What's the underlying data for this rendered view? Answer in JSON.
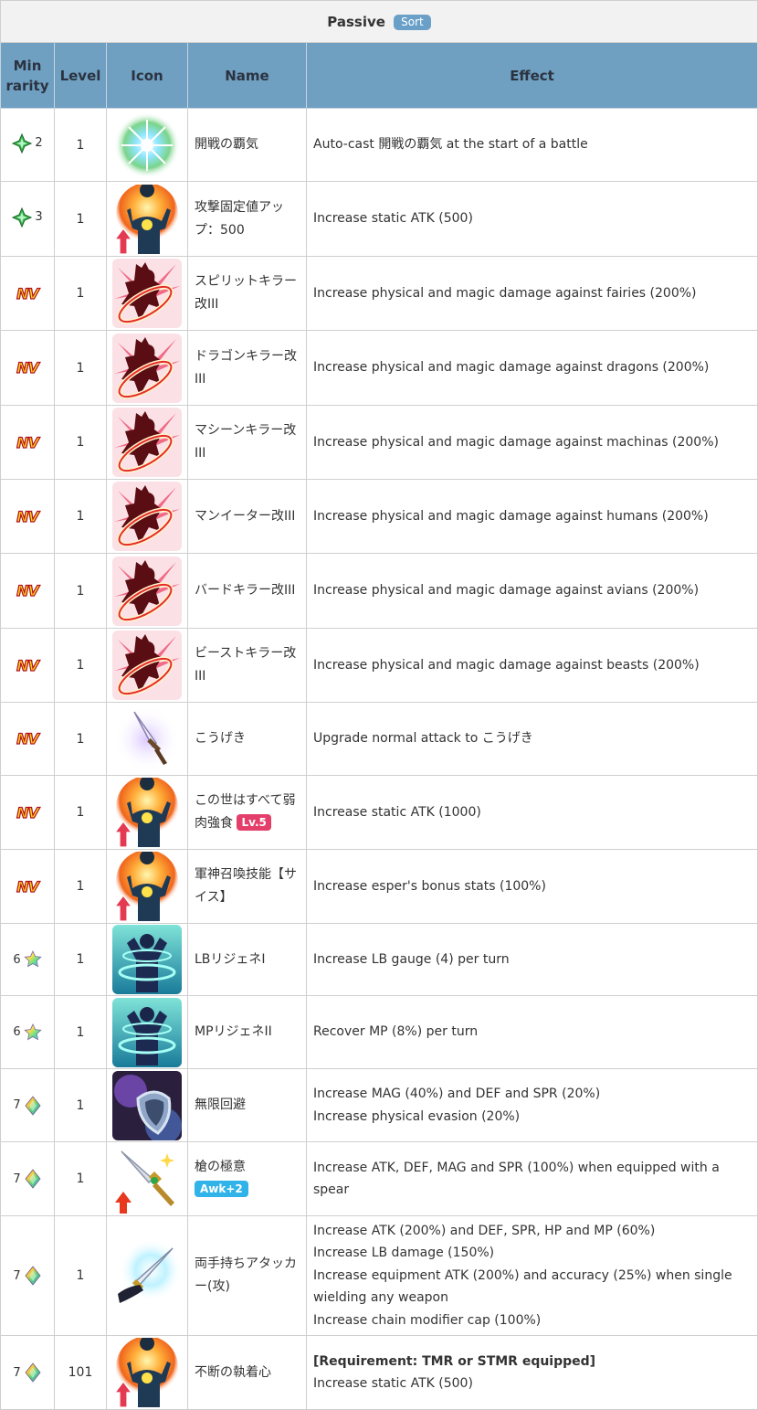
{
  "caption": {
    "title": "Passive",
    "sort_label": "Sort"
  },
  "headers": {
    "min_rarity_1": "Min",
    "min_rarity_2": "rarity",
    "level": "Level",
    "icon": "Icon",
    "name": "Name",
    "effect": "Effect"
  },
  "rows": [
    {
      "rarity": "2",
      "rarity_icon": "green-crystal-icon",
      "level": "1",
      "icon": "battle-aura-icon",
      "name": "開戦の覇気",
      "effects": [
        "Auto-cast 開戦の覇気 at the start of a battle"
      ]
    },
    {
      "rarity": "3",
      "rarity_icon": "green-crystal-icon",
      "level": "1",
      "icon": "stat-up-icon",
      "name": "攻撃固定値アップ：500",
      "effects": [
        "Increase static ATK (500)"
      ]
    },
    {
      "rarity": "NV",
      "rarity_icon": "nv-icon",
      "level": "1",
      "icon": "killer-icon",
      "name": "スピリットキラー改III",
      "effects": [
        "Increase physical and magic damage against fairies (200%)"
      ]
    },
    {
      "rarity": "NV",
      "rarity_icon": "nv-icon",
      "level": "1",
      "icon": "killer-icon",
      "name": "ドラゴンキラー改III",
      "effects": [
        "Increase physical and magic damage against dragons (200%)"
      ]
    },
    {
      "rarity": "NV",
      "rarity_icon": "nv-icon",
      "level": "1",
      "icon": "killer-icon",
      "name": "マシーンキラー改III",
      "effects": [
        "Increase physical and magic damage against machinas (200%)"
      ]
    },
    {
      "rarity": "NV",
      "rarity_icon": "nv-icon",
      "level": "1",
      "icon": "killer-icon",
      "name": "マンイーター改III",
      "effects": [
        "Increase physical and magic damage against humans (200%)"
      ]
    },
    {
      "rarity": "NV",
      "rarity_icon": "nv-icon",
      "level": "1",
      "icon": "killer-icon",
      "name": "バードキラー改III",
      "effects": [
        "Increase physical and magic damage against avians (200%)"
      ]
    },
    {
      "rarity": "NV",
      "rarity_icon": "nv-icon",
      "level": "1",
      "icon": "killer-icon",
      "name": "ビーストキラー改III",
      "effects": [
        "Increase physical and magic damage against beasts (200%)"
      ]
    },
    {
      "rarity": "NV",
      "rarity_icon": "nv-icon",
      "level": "1",
      "icon": "sword-icon",
      "name": "こうげき",
      "effects": [
        "Upgrade normal attack to こうげき"
      ]
    },
    {
      "rarity": "NV",
      "rarity_icon": "nv-icon",
      "level": "1",
      "icon": "stat-up-icon",
      "name": "この世はすべて弱肉強食",
      "badge": "Lv.5",
      "badge_type": "lv",
      "effects": [
        "Increase static ATK (1000)"
      ]
    },
    {
      "rarity": "NV",
      "rarity_icon": "nv-icon",
      "level": "1",
      "icon": "stat-up-icon",
      "name": "軍神召喚技能【サイス】",
      "effects": [
        "Increase esper's bonus stats (100%)"
      ]
    },
    {
      "rarity": "6",
      "rarity_icon": "rainbow-star-icon",
      "level": "1",
      "icon": "regen-icon",
      "name": "LBリジェネI",
      "effects": [
        "Increase LB gauge (4) per turn"
      ]
    },
    {
      "rarity": "6",
      "rarity_icon": "rainbow-star-icon",
      "level": "1",
      "icon": "regen-icon",
      "name": "MPリジェネII",
      "effects": [
        "Recover MP (8%) per turn"
      ]
    },
    {
      "rarity": "7",
      "rarity_icon": "prism-crystal-icon",
      "level": "1",
      "icon": "shield-evade-icon",
      "name": "無限回避",
      "effects": [
        "Increase MAG (40%) and DEF and SPR (20%)",
        "Increase physical evasion (20%)"
      ]
    },
    {
      "rarity": "7",
      "rarity_icon": "prism-crystal-icon",
      "level": "1",
      "icon": "spear-icon",
      "name": "槍の極意",
      "badge": "Awk+2",
      "badge_type": "awk",
      "effects": [
        "Increase ATK, DEF, MAG and SPR (100%) when equipped with a spear"
      ]
    },
    {
      "rarity": "7",
      "rarity_icon": "prism-crystal-icon",
      "level": "1",
      "icon": "dual-sword-icon",
      "name": "両手持ちアタッカー(攻)",
      "effects": [
        "Increase ATK (200%) and DEF, SPR, HP and MP (60%)",
        "Increase LB damage (150%)",
        "Increase equipment ATK (200%) and accuracy (25%) when single wielding any weapon",
        "Increase chain modifier cap (100%)"
      ]
    },
    {
      "rarity": "7",
      "rarity_icon": "prism-crystal-icon",
      "level": "101",
      "icon": "stat-up-icon",
      "name": "不断の執着心",
      "requirement": "[Requirement: TMR or STMR equipped]",
      "effects": [
        "Increase static ATK (500)"
      ]
    }
  ],
  "colors": {
    "header_bg": "#6f9fc1",
    "sort_badge": "#6aa0c8",
    "lv_badge": "#e43f6a",
    "awk_badge": "#2fb3e8"
  }
}
